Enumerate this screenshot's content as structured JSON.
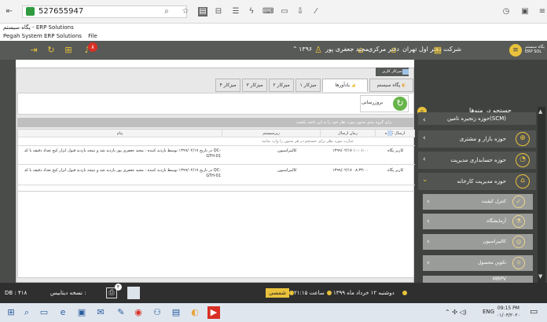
{
  "browser": {
    "address": "527655947",
    "icons": [
      "back-icon",
      "shield-icon",
      "search-icon",
      "star-icon",
      "document-icon",
      "tab-icon",
      "flash-icon",
      "keyboard-icon",
      "screen-icon",
      "download-icon",
      "pen-icon",
      "clock-icon",
      "square-icon",
      "menu-icon"
    ]
  },
  "window": {
    "title": "پگاه سیستم - ERP Solutions",
    "menu_app": "Pegah System ERP Solutions",
    "menu_file": "File"
  },
  "appbar": {
    "company": "شرکت دفتر اول تهران",
    "office": "دفتر مرکزی",
    "user": "مجید جعفری پور",
    "year": "۱۳۹۶",
    "notif_count": "۸",
    "brand": "پگاه سیستم ERP SOL"
  },
  "header_strip": "میزکار کاربر",
  "tabs": [
    {
      "label": "پگاه سیستم"
    },
    {
      "label": "یادآورها"
    },
    {
      "label": "میزکار ۱"
    },
    {
      "label": "میزکار ۲"
    },
    {
      "label": "میزکار ۳"
    },
    {
      "label": "میزکار ۴"
    }
  ],
  "refresh_label": "بروزرسانی",
  "info_text": "برای گروه بندی ستون مورد نظر خود را به این ناحیه بکشید",
  "grid": {
    "headers": [
      "ارسال کننده",
      "زمان ارسال",
      "زیرسیستم",
      "پیام"
    ],
    "filter_hint": "عبارت مورد نظر برای جستجو در هر ستون را وارد نمایید",
    "rows": [
      {
        "sender": "کاربر پگاه",
        "time": "۱۳۹۹/۰۲/۱۷ ۱۰:۰۱:۰۰",
        "subsystem": "کالیبراسیون",
        "message": "در تاریخ ۱۳۹۹/۰۲/۱۷ توسط بازدید کننده : مجید جعفری پور بازدید شد و نتیجه بازدید قبول ابزار کیج تعداد دقیقه با کد QC-GTH-01"
      },
      {
        "sender": "کاربر پگاه",
        "time": "۱۳۹۹/۰۲/۱۷ ۰۸:۳۳:۰۰",
        "subsystem": "کالیبراسیون",
        "message": "در تاریخ ۱۳۹۹/۰۲/۱۷ توسط بازدید کننده : مجید جعفری پور بازدید شد و نتیجه بازدید قبول ابزار کیج تعداد دقیقه با کد QC-GTH-01"
      }
    ]
  },
  "sidebar": {
    "search_label": "جستجو در منوها",
    "items": [
      {
        "label": "حوزه زنجیره تامین(SCM)"
      },
      {
        "label": "حوزه بازار و مشتری"
      },
      {
        "label": "حوزه حسابداری مدیریت"
      },
      {
        "label": "حوزه مدیریت کارخانه"
      }
    ],
    "subitems": [
      {
        "label": "کنترل کیفیت"
      },
      {
        "label": "آزمایشگاه"
      },
      {
        "label": "کالیبراسیون"
      },
      {
        "label": "تکوین محصول"
      },
      {
        "label": "MRPV"
      }
    ]
  },
  "status": {
    "db_label": "DB : ۴۱۸",
    "db_version_label": "نسخه دیتابیس :",
    "date": "دوشنبه ۱۲ خرداد ماه ۱۳۹۹",
    "time": "ساعت ۲۱:۱۵",
    "calendar": "شمسی",
    "badge_count": "۴"
  },
  "taskbar": {
    "lang": "ENG",
    "time": "09:15 PM",
    "date": "۰۱/۰۳/۲۰۲۰"
  }
}
